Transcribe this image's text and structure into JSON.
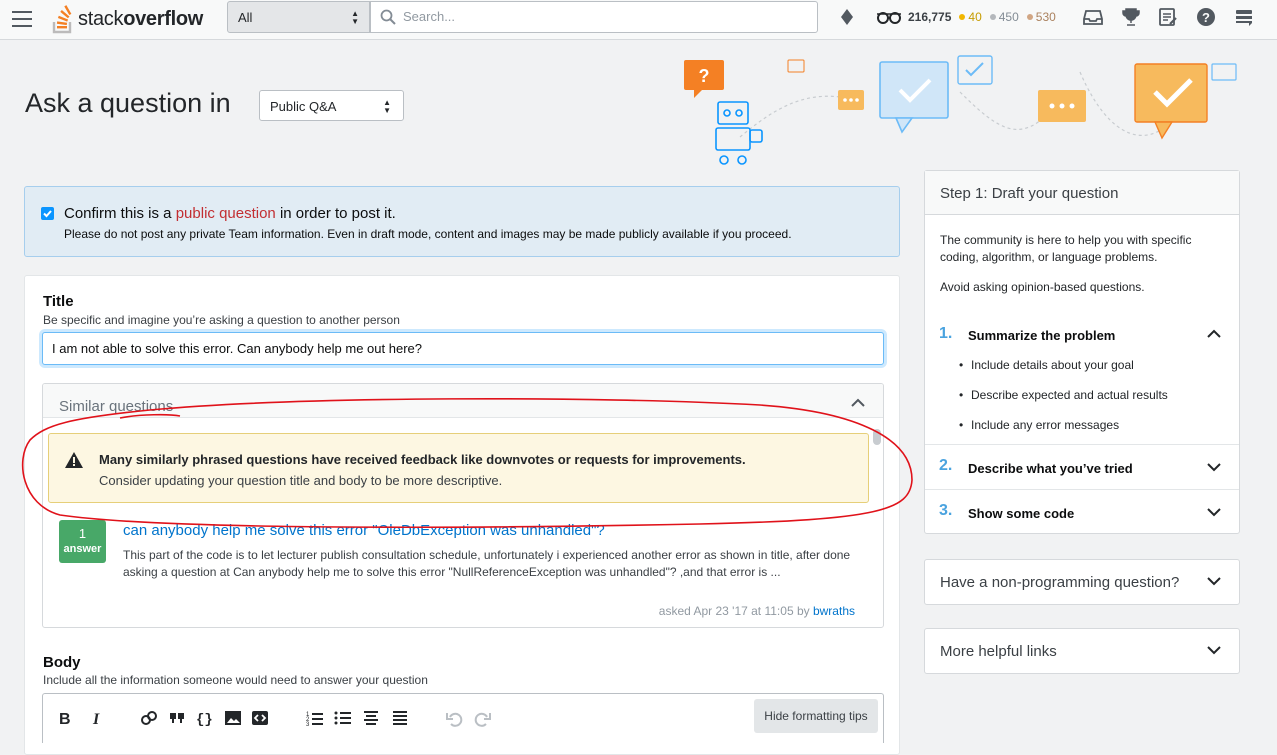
{
  "topbar": {
    "logo_text_light": "stack",
    "logo_text_bold": "overflow",
    "scope": "All",
    "search_placeholder": "Search...",
    "reputation": "216,775",
    "gold": "40",
    "silver": "450",
    "bronze": "530",
    "colors": {
      "gold": "#f1b600",
      "silver": "#b4b8bc",
      "bronze": "#d1a684",
      "logo_orange": "#f48024"
    }
  },
  "header": {
    "title": "Ask a question in",
    "location_select": "Public Q&A"
  },
  "confirm": {
    "prefix": "Confirm this is a ",
    "link": "public question",
    "suffix": " in order to post it.",
    "note": "Please do not post any private Team information. Even in draft mode, content and images may be made publicly available if you proceed."
  },
  "form": {
    "title_label": "Title",
    "title_desc": "Be specific and imagine you’re asking a question to another person",
    "title_value": "I am not able to solve this error. Can anybody help me out here?",
    "similar_heading": "Similar questions",
    "warning_bold": "Many similarly phrased questions have received feedback like downvotes or requests for improvements.",
    "warning_text": "Consider updating your question title and body to be more descriptive.",
    "similar_item": {
      "answer_count": "1",
      "answer_word": "answer",
      "title": "can anybody help me solve this error \"OleDbException was unhandled\"?",
      "excerpt": "This part of the code is to let lecturer publish consultation schedule, unfortunately i experienced another error as shown in title, after done asking a question at Can anybody help me to solve this error \"NullReferenceException was unhandled\"? ,and that error is ...",
      "asked": "asked Apr 23 '17 at 11:05 by ",
      "user": "bwraths"
    },
    "body_label": "Body",
    "body_desc": "Include all the information someone would need to answer your question",
    "hide_tips": "Hide formatting tips"
  },
  "sidebar": {
    "step_heading": "Step 1: Draft your question",
    "intro": "The community is here to help you with specific coding, algorithm, or language problems.",
    "avoid": "Avoid asking opinion-based questions.",
    "steps": [
      {
        "num": "1.",
        "title": "Summarize the problem",
        "bullets": [
          "Include details about your goal",
          "Describe expected and actual results",
          "Include any error messages"
        ]
      },
      {
        "num": "2.",
        "title": "Describe what you’ve tried"
      },
      {
        "num": "3.",
        "title": "Show some code"
      }
    ],
    "non_programming": "Have a non-programming question?",
    "more_links": "More helpful links"
  }
}
